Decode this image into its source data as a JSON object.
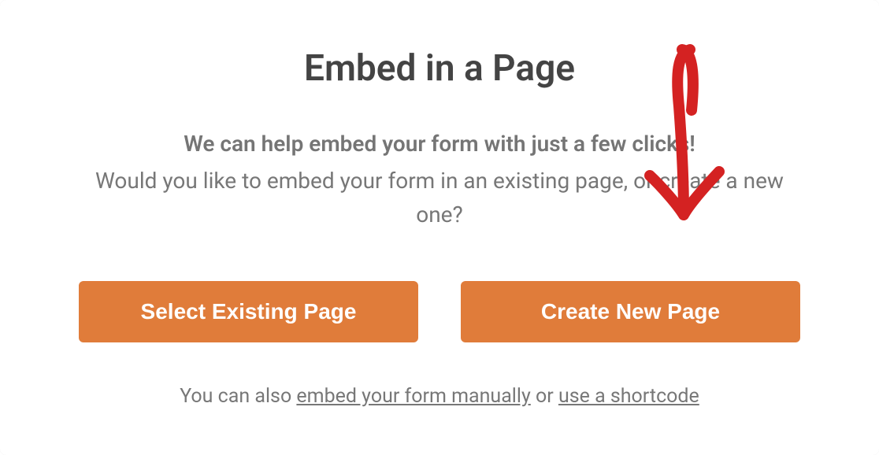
{
  "modal": {
    "title": "Embed in a Page",
    "lead": "We can help embed your form with just a few clicks!",
    "sub": "Would you like to embed your form in an existing page, or create a new one?",
    "buttons": {
      "select_existing": "Select Existing Page",
      "create_new": "Create New Page"
    },
    "footer": {
      "prefix": "You can also ",
      "link_embed": "embed your form manually",
      "middle": " or ",
      "link_shortcode": "use a shortcode"
    }
  },
  "annotation": {
    "arrow": "hand-drawn-arrow-down"
  },
  "colors": {
    "button_bg": "#e07c3a",
    "text_dark": "#444444",
    "text_muted": "#777777",
    "arrow": "#d42222"
  }
}
